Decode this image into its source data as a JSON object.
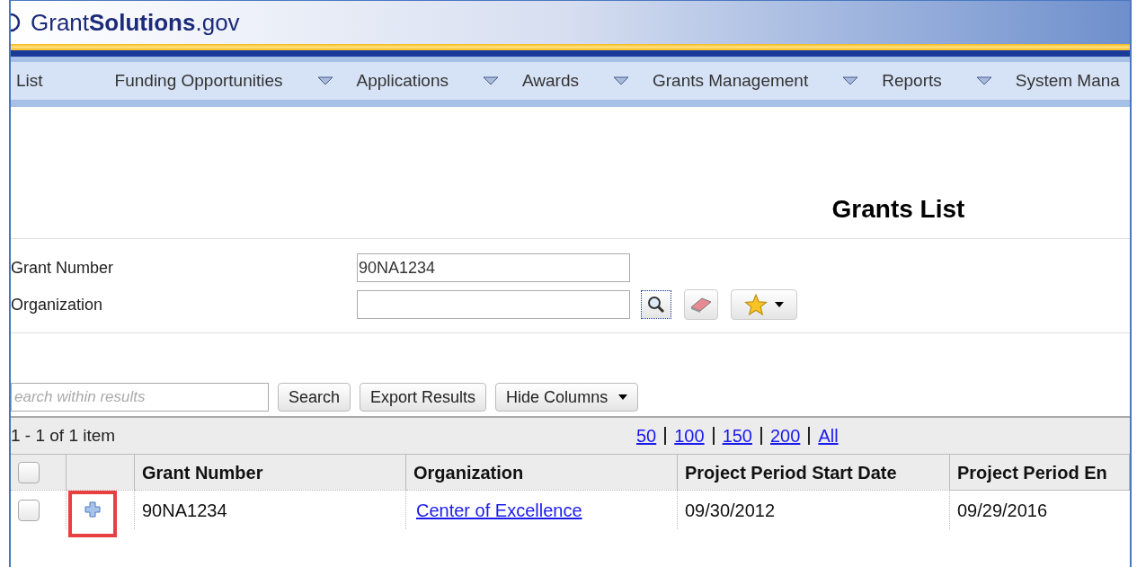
{
  "header": {
    "logo_text": "Grant**Solutions**.gov"
  },
  "nav": [
    {
      "label": "List",
      "dropdown": false
    },
    {
      "label": "Funding Opportunities",
      "dropdown": true
    },
    {
      "label": "Applications",
      "dropdown": true
    },
    {
      "label": "Awards",
      "dropdown": true
    },
    {
      "label": "Grants Management",
      "dropdown": true
    },
    {
      "label": "Reports",
      "dropdown": true
    },
    {
      "label": "System Mana",
      "dropdown": false
    }
  ],
  "page_title": "Grants List",
  "filters": [
    {
      "label": "Grant Number",
      "value": "90NA1234"
    },
    {
      "label": "Organization"
    }
  ],
  "toolbar": {
    "search_placeholder": "earch within results",
    "buttons": [
      {
        "label": "Search",
        "dropdown": false
      },
      {
        "label": "Export Results",
        "dropdown": false
      },
      {
        "label": "Hide Columns",
        "dropdown": true
      }
    ]
  },
  "pager": {
    "summary": "1 - 1 of 1 item",
    "page_sizes": [
      "50",
      "100",
      "150",
      "200",
      "All"
    ]
  },
  "table": {
    "select_all_checked": false,
    "columns": [
      "Grant Number",
      "Organization",
      "Project Period Start Date",
      "Project Period En"
    ],
    "rows": [
      {
        "checked": false,
        "highlighted": true,
        "grant_number": "90NA1234",
        "organization": "Center of Excellence",
        "start_date": "09/30/2012",
        "end_date": "09/29/2016"
      }
    ]
  }
}
